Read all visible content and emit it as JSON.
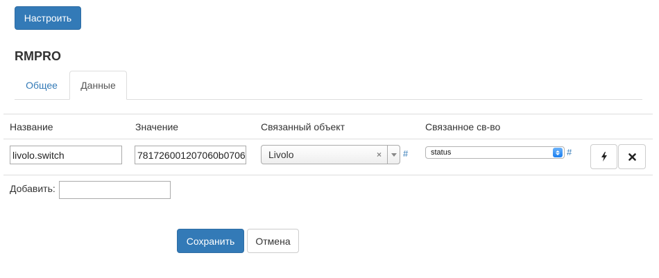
{
  "toolbar": {
    "configure_label": "Настроить"
  },
  "device": {
    "title": "RMPRO"
  },
  "tabs": [
    {
      "label": "Общее",
      "active": false
    },
    {
      "label": "Данные",
      "active": true
    }
  ],
  "table": {
    "headers": [
      "Название",
      "Значение",
      "Связанный объект",
      "Связанное св-во"
    ],
    "row": {
      "name": "livolo.switch",
      "value": "781726001207060b0706",
      "linked_object": "Livolo",
      "linked_object_clear": "×",
      "object_hash": "#",
      "linked_property": "status",
      "property_hash": "#",
      "actions": [
        "bolt-icon",
        "close-icon"
      ]
    }
  },
  "add": {
    "label": "Добавить:",
    "value": ""
  },
  "form": {
    "save_label": "Сохранить",
    "cancel_label": "Отмена"
  },
  "colors": {
    "primary": "#337ab7",
    "border": "#dddddd",
    "text": "#333333"
  }
}
